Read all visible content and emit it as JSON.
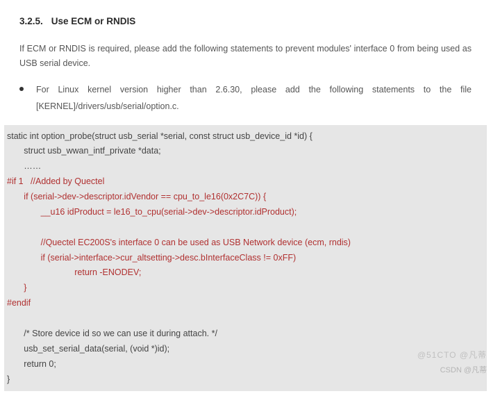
{
  "heading": {
    "number": "3.2.5.",
    "title": "Use ECM or RNDIS"
  },
  "intro": "If ECM or RNDIS is required, please add the following statements to prevent modules' interface 0 from being used as USB serial device.",
  "bullet": "For Linux kernel version higher than 2.6.30, please add the following statements to the file [KERNEL]/drivers/usb/serial/option.c.",
  "code": {
    "line1": "static int option_probe(struct usb_serial *serial, const struct usb_device_id *id) {",
    "line2": "       struct usb_wwan_intf_private *data;",
    "line3": "       ……",
    "r1": "#if 1   //Added by Quectel",
    "r2": "       if (serial->dev->descriptor.idVendor == cpu_to_le16(0x2C7C)) {",
    "r3": "              __u16 idProduct = le16_to_cpu(serial->dev->descriptor.idProduct);",
    "r4": "",
    "r5": "              //Quectel EC200S's interface 0 can be used as USB Network device (ecm, rndis)",
    "r6": "              if (serial->interface->cur_altsetting->desc.bInterfaceClass != 0xFF)",
    "r7": "                            return -ENODEV;",
    "r8": "       }",
    "r9": "#endif",
    "line4": "",
    "line5": "       /* Store device id so we can use it during attach. */",
    "line6": "       usb_set_serial_data(serial, (void *)id);",
    "line7": "       return 0;",
    "line8": "}"
  },
  "watermark1": "@51CTO @凡蒂",
  "watermark2": "CSDN @凡蒂"
}
